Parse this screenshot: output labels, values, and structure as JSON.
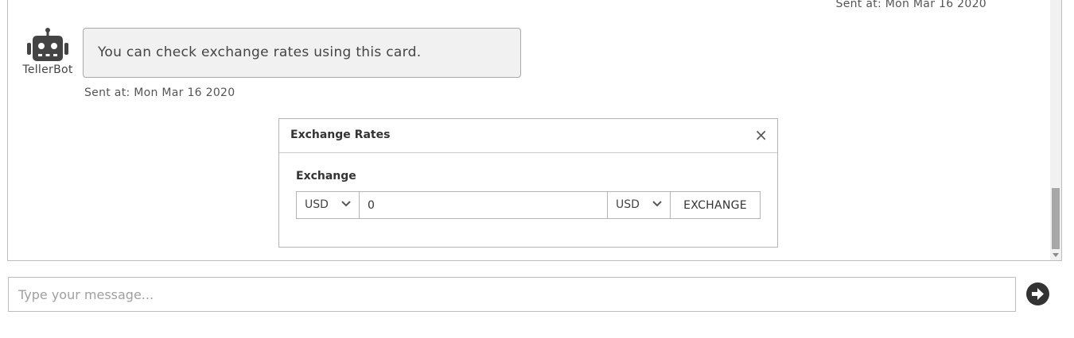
{
  "chat": {
    "top_timestamp": "Sent at: Mon Mar 16 2020",
    "bot_name": "TellerBot",
    "bot_message": "You can check exchange rates using this card.",
    "bot_timestamp": "Sent at: Mon Mar 16 2020"
  },
  "card": {
    "title": "Exchange Rates",
    "close_symbol": "×",
    "field_label": "Exchange",
    "from_currency": "USD",
    "amount_value": "0",
    "to_currency": "USD",
    "exchange_button_label": "EXCHANGE"
  },
  "composer": {
    "placeholder": "Type your message..."
  },
  "icons": {
    "avatar": "robot-icon",
    "dropdown": "chevron-down-icon",
    "send": "arrow-right-circle-icon"
  },
  "colors": {
    "bubble_bg": "#f1f1f1",
    "icon_dark": "#333333"
  }
}
